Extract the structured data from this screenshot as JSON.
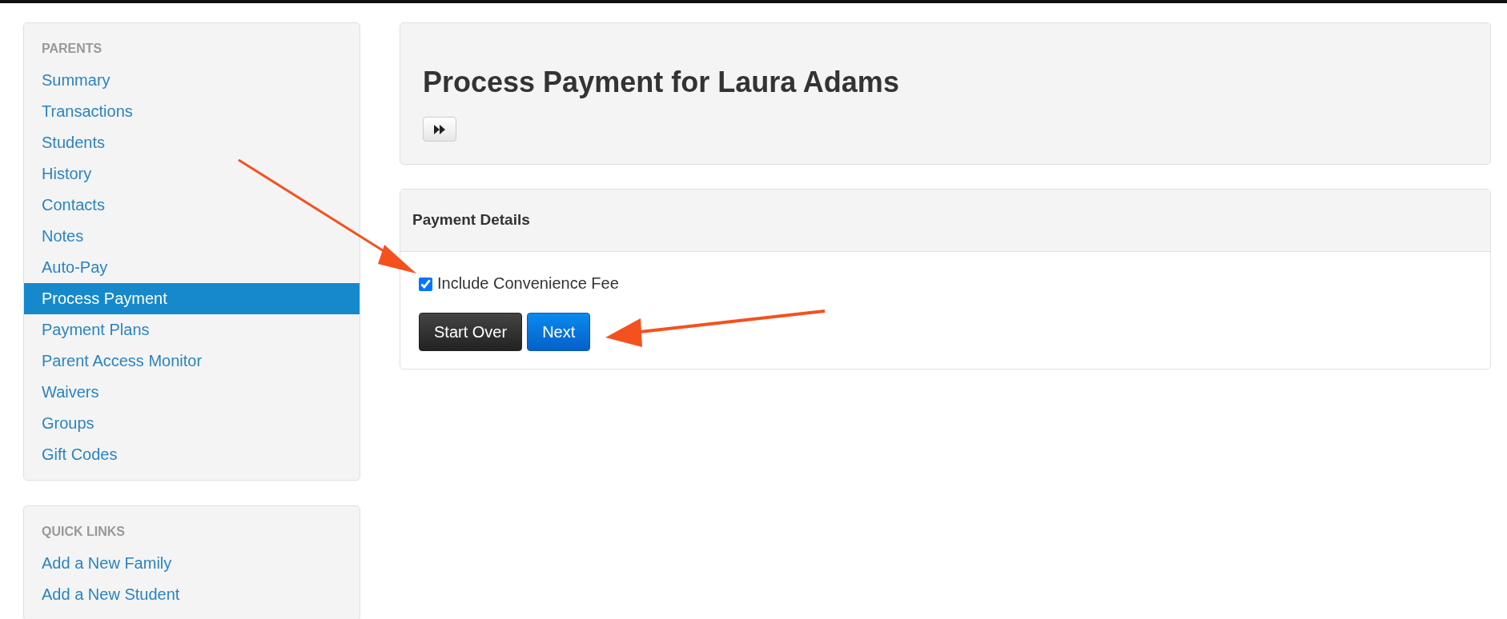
{
  "sidebar": {
    "sections": [
      {
        "heading": "PARENTS",
        "items": [
          {
            "label": "Summary",
            "selected": false
          },
          {
            "label": "Transactions",
            "selected": false
          },
          {
            "label": "Students",
            "selected": false
          },
          {
            "label": "History",
            "selected": false
          },
          {
            "label": "Contacts",
            "selected": false
          },
          {
            "label": "Notes",
            "selected": false
          },
          {
            "label": "Auto-Pay",
            "selected": false
          },
          {
            "label": "Process Payment",
            "selected": true
          },
          {
            "label": "Payment Plans",
            "selected": false
          },
          {
            "label": "Parent Access Monitor",
            "selected": false
          },
          {
            "label": "Waivers",
            "selected": false
          },
          {
            "label": "Groups",
            "selected": false
          },
          {
            "label": "Gift Codes",
            "selected": false
          }
        ]
      },
      {
        "heading": "QUICK LINKS",
        "items": [
          {
            "label": "Add a New Family",
            "selected": false
          },
          {
            "label": "Add a New Student",
            "selected": false
          }
        ]
      }
    ]
  },
  "page_header": {
    "title": "Process Payment for Laura Adams"
  },
  "payment_details": {
    "title": "Payment Details",
    "checkbox": {
      "label": "Include Convenience Fee",
      "checked": true
    },
    "buttons": [
      {
        "label": "Start Over",
        "kind": "dark"
      },
      {
        "label": "Next",
        "kind": "primary"
      }
    ]
  }
}
